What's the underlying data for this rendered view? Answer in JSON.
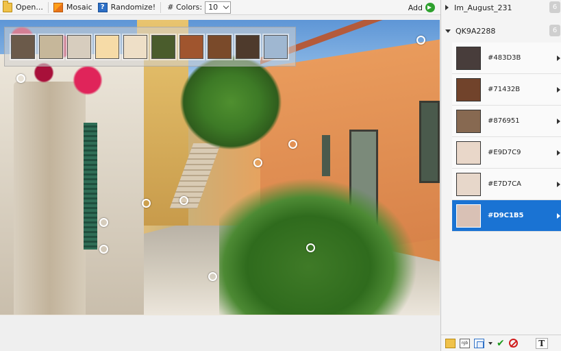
{
  "toolbar": {
    "open_label": "Open...",
    "mosaic_label": "Mosaic",
    "randomize_label": "Randomize!",
    "colors_label": "# Colors:",
    "colors_value": "10",
    "add_label": "Add"
  },
  "icons": {
    "open": "folder-icon",
    "mosaic": "mosaic-icon",
    "randomize": "help-icon",
    "add": "arrow-right-circle-icon"
  },
  "palette": [
    "#6B5A4A",
    "#C6B79A",
    "#D7CDBE",
    "#F6DBA7",
    "#EEDFC7",
    "#4A5C2C",
    "#A0552E",
    "#7A4A2A",
    "#4E3A2C",
    "#9FB7D1"
  ],
  "groups": [
    {
      "name": "Im_August_231",
      "count": "6",
      "expanded": false
    },
    {
      "name": "QK9A2288",
      "count": "6",
      "expanded": true
    }
  ],
  "colors": [
    {
      "hex": "#483D3B"
    },
    {
      "hex": "#71432B"
    },
    {
      "hex": "#876951"
    },
    {
      "hex": "#E9D7C9"
    },
    {
      "hex": "#E7D7CA"
    },
    {
      "hex": "#D9C1B5"
    }
  ],
  "selected_color_index": 5,
  "footer": {
    "text_tool_label": "T"
  }
}
